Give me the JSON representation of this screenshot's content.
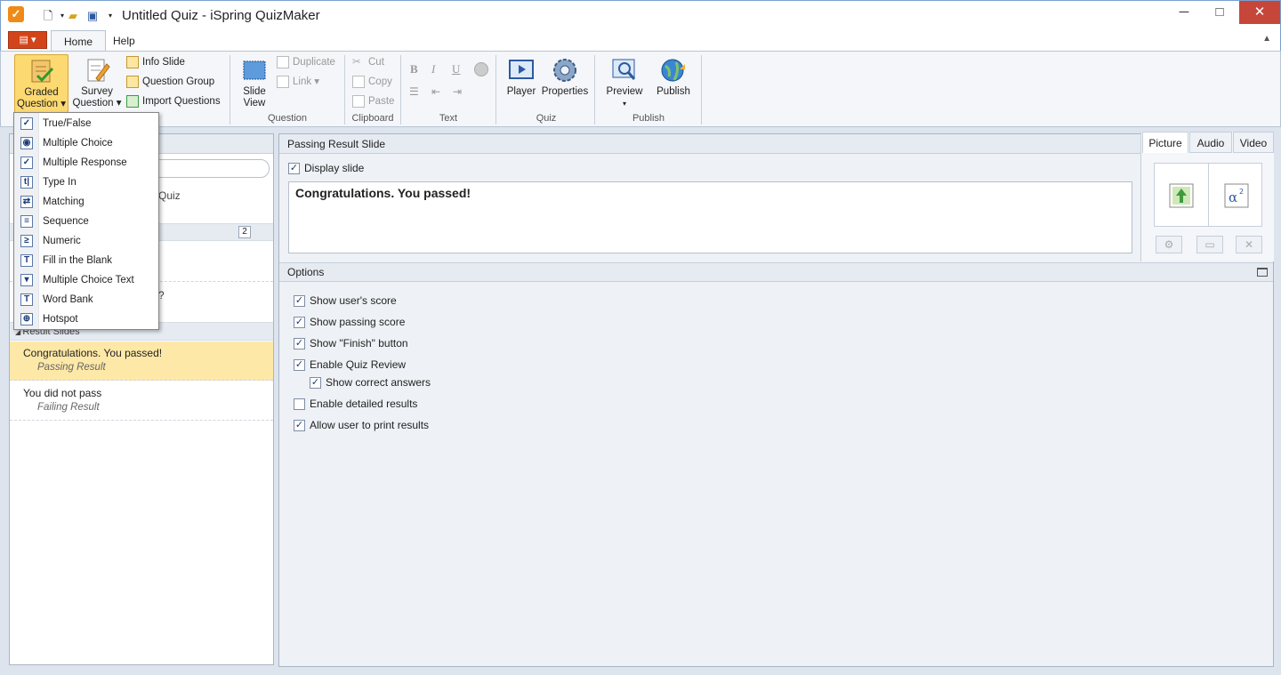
{
  "window": {
    "title": "Untitled Quiz - iSpring QuizMaker",
    "minimize": "─",
    "maximize": "□",
    "close": "✕"
  },
  "menu_tabs": [
    "Home",
    "Help"
  ],
  "ribbon": {
    "graded": {
      "line1": "Graded",
      "line2": "Question ▾"
    },
    "survey": {
      "line1": "Survey",
      "line2": "Question ▾"
    },
    "info_slide": "Info Slide",
    "question_group": "Question Group",
    "import_questions": "Import Questions",
    "slide_view": {
      "line1": "Slide",
      "line2": "View"
    },
    "duplicate": "Duplicate",
    "link": "Link ▾",
    "group_question": "Question",
    "cut": "Cut",
    "copy": "Copy",
    "paste": "Paste",
    "group_clipboard": "Clipboard",
    "group_text": "Text",
    "bold": "B",
    "italic": "I",
    "underline": "U",
    "player": "Player",
    "properties": "Properties",
    "group_quiz": "Quiz",
    "preview": "Preview",
    "preview_arrow": "▾",
    "publish": "Publish",
    "group_publish": "Publish"
  },
  "dropdown": {
    "items": [
      {
        "label": "True/False",
        "icon": "true-false-icon",
        "glyph": "✓"
      },
      {
        "label": "Multiple Choice",
        "icon": "radio-icon",
        "glyph": "◉"
      },
      {
        "label": "Multiple Response",
        "icon": "checkbox-icon",
        "glyph": "✓"
      },
      {
        "label": "Type In",
        "icon": "type-in-icon",
        "glyph": "t|"
      },
      {
        "label": "Matching",
        "icon": "matching-icon",
        "glyph": "⇄"
      },
      {
        "label": "Sequence",
        "icon": "sequence-icon",
        "glyph": "≡"
      },
      {
        "label": "Numeric",
        "icon": "numeric-icon",
        "glyph": "≥"
      },
      {
        "label": "Fill in the Blank",
        "icon": "fill-blank-icon",
        "glyph": "T"
      },
      {
        "label": "Multiple Choice Text",
        "icon": "mc-text-icon",
        "glyph": "▾"
      },
      {
        "label": "Word Bank",
        "icon": "word-bank-icon",
        "glyph": "T"
      },
      {
        "label": "Hotspot",
        "icon": "hotspot-icon",
        "glyph": "⊕"
      }
    ]
  },
  "left_panel": {
    "partial_quiz": "Quiz",
    "count_badge": "2",
    "partial_question": "?",
    "result_slides_header": "Result Slides",
    "results": [
      {
        "title": "Congratulations. You passed!",
        "subtitle": "Passing Result",
        "selected": true
      },
      {
        "title": "You did not pass",
        "subtitle": "Failing Result",
        "selected": false
      }
    ]
  },
  "slide_editor": {
    "header": "Passing Result Slide",
    "display_slide_label": "Display slide",
    "message": "Congratulations. You passed!"
  },
  "media_tabs": [
    "Picture",
    "Audio",
    "Video"
  ],
  "options": {
    "header": "Options",
    "items": [
      {
        "label": "Show user's score",
        "checked": true
      },
      {
        "label": "Show passing score",
        "checked": true
      },
      {
        "label": "Show \"Finish\" button",
        "checked": true
      },
      {
        "label": "Enable Quiz Review",
        "checked": true
      },
      {
        "label": "Show correct answers",
        "checked": true,
        "indent": true
      },
      {
        "label": "Enable detailed results",
        "checked": false
      },
      {
        "label": "Allow user to print results",
        "checked": true
      }
    ]
  },
  "colors": {
    "accent_orange": "#d2451b",
    "selected_row": "#fde8a7",
    "pressed_button": "#fcd971"
  }
}
